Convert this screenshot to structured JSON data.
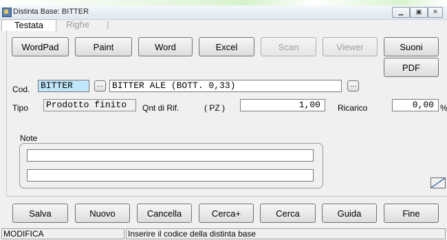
{
  "window": {
    "title": "Distinta Base: BITTER",
    "controls": [
      "minimize-icon",
      "maximize-icon",
      "close-icon"
    ]
  },
  "tabs": [
    {
      "label": "Testata",
      "active": true
    },
    {
      "label": "Righe",
      "active": false
    }
  ],
  "toolbar": {
    "wordpad": "WordPad",
    "paint": "Paint",
    "word": "Word",
    "excel": "Excel",
    "scan": "Scan",
    "viewer": "Viewer",
    "suoni": "Suoni",
    "pdf": "PDF"
  },
  "form": {
    "cod_label": "Cod.",
    "cod_value": "BITTER",
    "description_value": "BITTER ALE (BOTT. 0,33)",
    "tipo_label": "Tipo",
    "tipo_value": "Prodotto finito",
    "qnt_label": "Qnt di Rif.",
    "unit_label": "( PZ )",
    "qnt_value": "1,00",
    "ricarico_label": "Ricarico",
    "ricarico_value": "0,00",
    "ricarico_unit": "%",
    "note_label": "Note",
    "note_line_1": "",
    "note_line_2": ""
  },
  "actions": {
    "salva": "Salva",
    "nuovo": "Nuovo",
    "cancella": "Cancella",
    "cerca_plus": "Cerca+",
    "cerca": "Cerca",
    "guida": "Guida",
    "fine": "Fine"
  },
  "status": {
    "mode": "MODIFICA",
    "message": "Inserire il codice della distinta base"
  },
  "colors": {
    "cod_highlight": "#bfe6fb",
    "window_bg": "#f0f0f0"
  }
}
